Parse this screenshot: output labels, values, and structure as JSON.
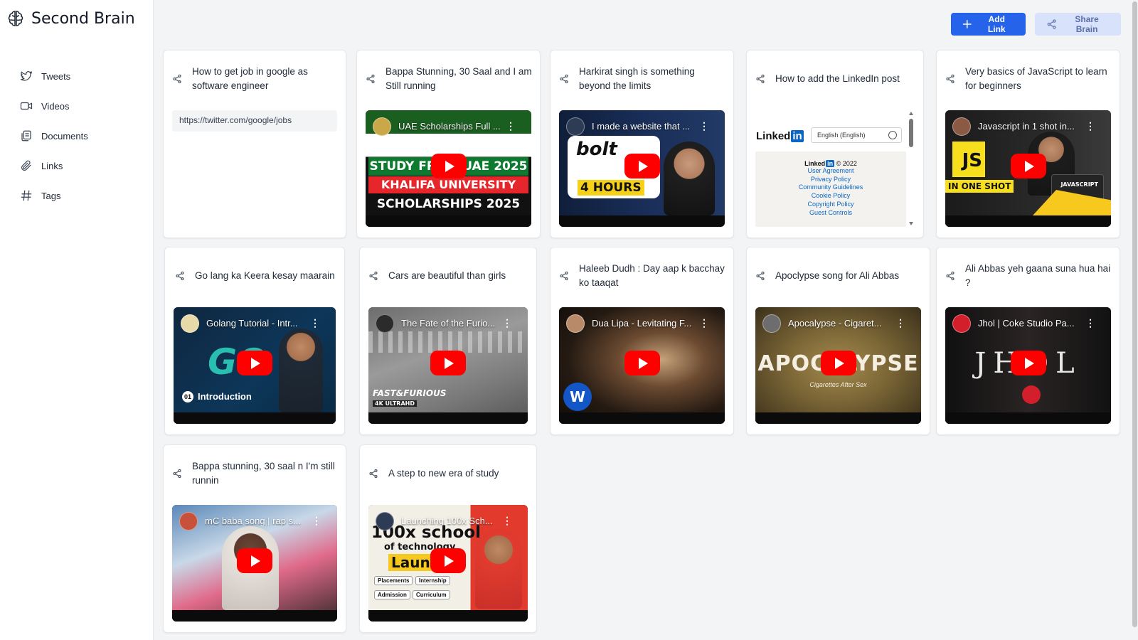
{
  "app": {
    "title": "Second Brain",
    "logo_icon": "brain-icon"
  },
  "sidebar": {
    "items": [
      {
        "label": "Tweets",
        "icon": "twitter-icon"
      },
      {
        "label": "Videos",
        "icon": "video-icon"
      },
      {
        "label": "Documents",
        "icon": "document-icon"
      },
      {
        "label": "Links",
        "icon": "paperclip-icon"
      },
      {
        "label": "Tags",
        "icon": "hash-icon"
      }
    ]
  },
  "header": {
    "add_link_label": "Add Link",
    "share_brain_label": "Share Brain",
    "accent_color": "#2563eb",
    "secondary_color": "#d9e2fb"
  },
  "cards": [
    {
      "title": "How to get job in google as software engineer",
      "type": "tweet",
      "link": "https://twitter.com/google/jobs"
    },
    {
      "title": "Bappa Stunning, 30 Saal and I am Still running",
      "type": "youtube",
      "video_title": "UAE Scholarships Full ..."
    },
    {
      "title": "Harkirat singh is something beyond the limits",
      "type": "youtube",
      "video_title": "I made a website that ..."
    },
    {
      "title": "How to add the LinkedIn post",
      "type": "linkedin",
      "embed": {
        "logo_text": "Linked",
        "logo_in": "in",
        "language": "English (English)",
        "copyright": "© 2022",
        "links": [
          "User Agreement",
          "Privacy Policy",
          "Community Guidelines",
          "Cookie Policy",
          "Copyright Policy",
          "Guest Controls"
        ]
      }
    },
    {
      "title": "Very basics of JavaScript to learn for beginners",
      "type": "youtube",
      "video_title": "Javascript in 1 shot in..."
    },
    {
      "title": "Go lang ka Keera kesay maarain",
      "type": "youtube",
      "video_title": "Golang Tutorial - Intr..."
    },
    {
      "title": "Cars are beautiful than girls",
      "type": "youtube",
      "video_title": "The Fate of the Furio..."
    },
    {
      "title": "Haleeb Dudh : Day aap k bacchay ko taaqat",
      "type": "youtube",
      "video_title": "Dua Lipa - Levitating F..."
    },
    {
      "title": "Apoclypse song for Ali Abbas",
      "type": "youtube",
      "video_title": "Apocalypse - Cigaret..."
    },
    {
      "title": "Ali Abbas yeh gaana suna hua hai ?",
      "type": "youtube",
      "video_title": "Jhol | Coke Studio Pa..."
    },
    {
      "title": "Bappa stunning, 30 saal n I'm still runnin",
      "type": "youtube",
      "video_title": "mC baba song | rap s..."
    },
    {
      "title": "A step to new era of study",
      "type": "youtube",
      "video_title": "Launching 100x Sch..."
    }
  ],
  "thumbs": {
    "uae": {
      "l1": "STUDY FROM UAE 2025",
      "l2": "KHALIFA UNIVERSITY",
      "l3": "SCHOLARSHIPS 2025"
    },
    "bolt": {
      "brand": "bolt",
      "hours": "4 HOURS"
    },
    "js": {
      "badge": "JS",
      "caption": "IN ONE SHOT",
      "laptop": "JAVASCRIPT"
    },
    "go": {
      "logo": "GO",
      "num": "01",
      "caption": "Introduction"
    },
    "ff": {
      "brand": "FAST&FURIOUS",
      "tag": "4K ULTRAHD"
    },
    "apoc": {
      "word": "APOCALYPSE",
      "sub": "Cigarettes After Sex"
    },
    "jhol": {
      "word": "JHOL"
    },
    "school": {
      "l1": "100x school",
      "l2": "of technology",
      "l3": "Launch",
      "tags": [
        "Placements",
        "Internship",
        "Admission",
        "Curriculum"
      ]
    }
  }
}
